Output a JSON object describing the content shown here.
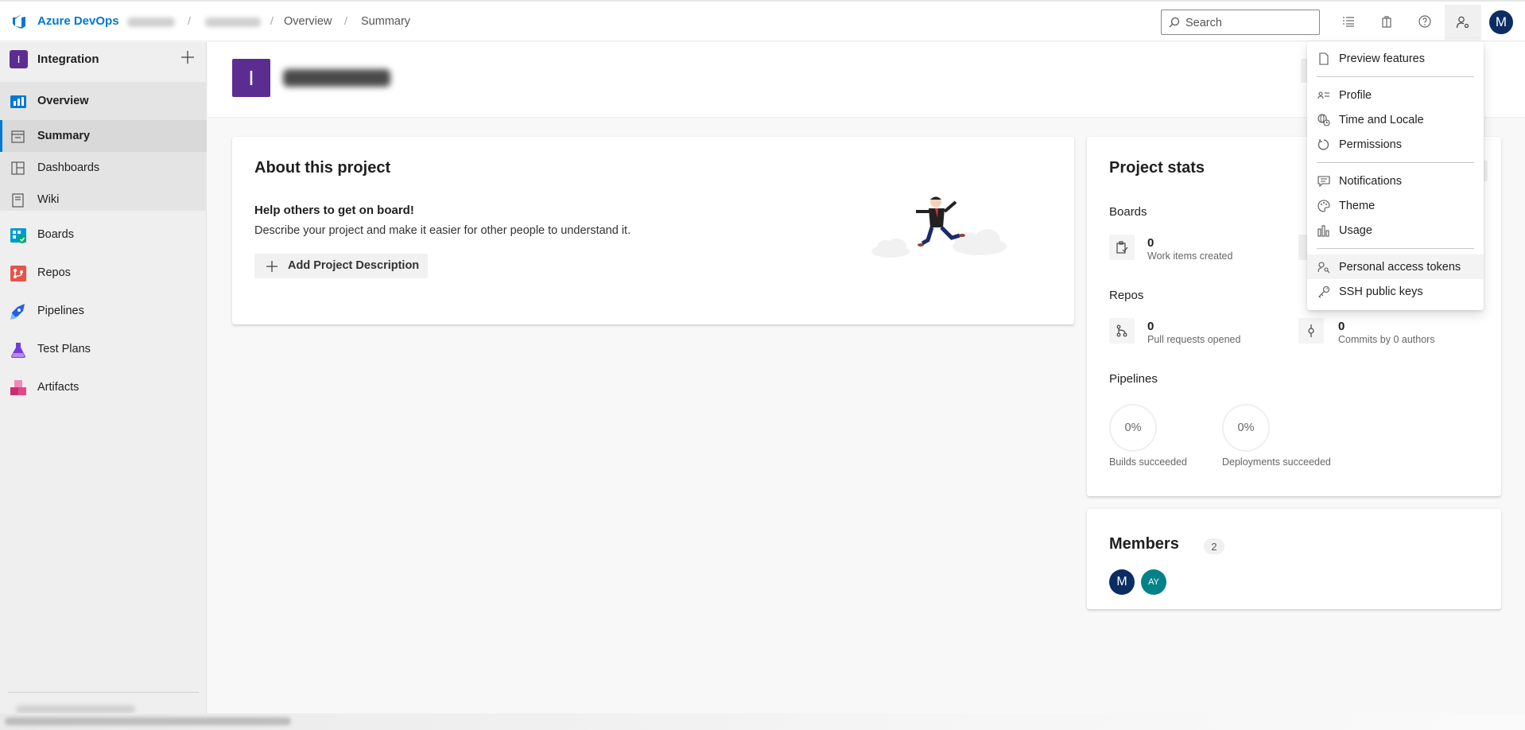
{
  "topbar": {
    "brand": "Azure DevOps",
    "breadcrumb": [
      "Overview",
      "Summary"
    ],
    "breadcrumb_sep": "/",
    "search_placeholder": "Search",
    "user_initial": "M"
  },
  "sidebar": {
    "project_initial": "I",
    "project_name": "Integration",
    "items": [
      {
        "label": "Overview"
      },
      {
        "label": "Summary"
      },
      {
        "label": "Dashboards"
      },
      {
        "label": "Wiki"
      },
      {
        "label": "Boards"
      },
      {
        "label": "Repos"
      },
      {
        "label": "Pipelines"
      },
      {
        "label": "Test Plans"
      },
      {
        "label": "Artifacts"
      }
    ]
  },
  "header": {
    "project_initial": "I"
  },
  "about": {
    "title": "About this project",
    "help": "Help others to get on board!",
    "description": "Describe your project and make it easier for other people to understand it.",
    "add_button": "Add Project Description"
  },
  "stats": {
    "title": "Project stats",
    "boards_label": "Boards",
    "work_items_count": "0",
    "work_items_caption": "Work items created",
    "repos_label": "Repos",
    "pull_requests_count": "0",
    "pull_requests_caption": "Pull requests opened",
    "commits_count": "0",
    "commits_caption": "Commits by 0 authors",
    "pipelines_label": "Pipelines",
    "builds_pct": "0%",
    "builds_caption": "Builds succeeded",
    "deployments_pct": "0%",
    "deployments_caption": "Deployments succeeded"
  },
  "members": {
    "title": "Members",
    "count": "2",
    "avatars": [
      {
        "initials": "M",
        "color": "#0b2d64"
      },
      {
        "initials": "AY",
        "color": "#038387"
      }
    ]
  },
  "user_menu": {
    "items": [
      {
        "label": "Preview features",
        "icon": "page-icon"
      },
      {
        "label": "Profile",
        "icon": "contact-card-icon"
      },
      {
        "label": "Time and Locale",
        "icon": "globe-clock-icon"
      },
      {
        "label": "Permissions",
        "icon": "permissions-icon"
      },
      {
        "label": "Notifications",
        "icon": "notification-icon"
      },
      {
        "label": "Theme",
        "icon": "palette-icon"
      },
      {
        "label": "Usage",
        "icon": "bar-chart-icon"
      },
      {
        "label": "Personal access tokens",
        "icon": "token-icon"
      },
      {
        "label": "SSH public keys",
        "icon": "key-icon"
      }
    ]
  },
  "colors": {
    "accent": "#0078d4",
    "project_purple": "#5c2d91"
  }
}
